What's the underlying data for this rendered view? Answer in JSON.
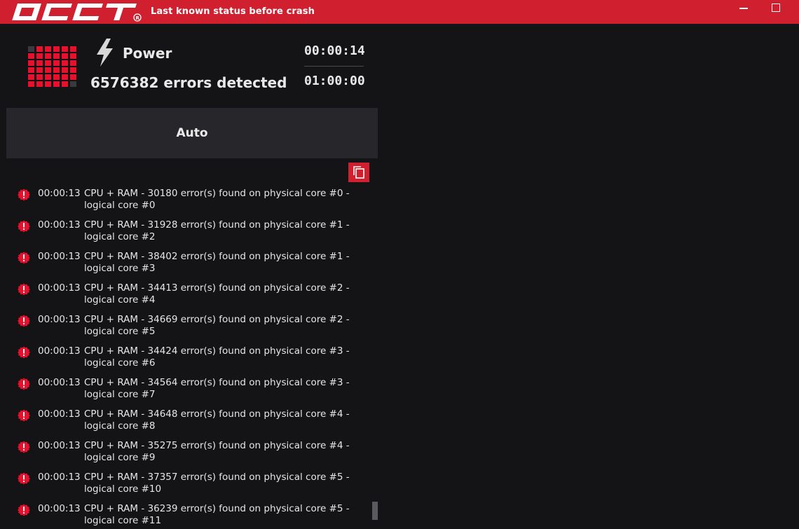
{
  "app": {
    "logo_text": "OCCT",
    "title": "Last known status before crash"
  },
  "window_controls": {
    "minimize_icon": "minimize-icon",
    "maximize_icon": "maximize-icon"
  },
  "colors": {
    "brand_red": "#d0202f",
    "background": "#141416",
    "panel": "#27272b"
  },
  "status": {
    "test_icon": "lightning-bolt-icon",
    "test_name": "Power",
    "errors_detected": "6576382 errors detected",
    "time_elapsed": "00:00:14",
    "time_total": "01:00:00"
  },
  "mode": {
    "label": "Auto"
  },
  "log": {
    "copy_icon": "copy-icon",
    "entries": [
      {
        "time": "00:00:13",
        "message": "CPU + RAM - 30180 error(s) found on physical core #0 - logical core #0"
      },
      {
        "time": "00:00:13",
        "message": "CPU + RAM - 31928 error(s) found on physical core #1 - logical core #2"
      },
      {
        "time": "00:00:13",
        "message": "CPU + RAM - 38402 error(s) found on physical core #1 - logical core #3"
      },
      {
        "time": "00:00:13",
        "message": "CPU + RAM - 34413 error(s) found on physical core #2 - logical core #4"
      },
      {
        "time": "00:00:13",
        "message": "CPU + RAM - 34669 error(s) found on physical core #2 - logical core #5"
      },
      {
        "time": "00:00:13",
        "message": "CPU + RAM - 34424 error(s) found on physical core #3 - logical core #6"
      },
      {
        "time": "00:00:13",
        "message": "CPU + RAM - 34564 error(s) found on physical core #3 - logical core #7"
      },
      {
        "time": "00:00:13",
        "message": "CPU + RAM - 34648 error(s) found on physical core #4 - logical core #8"
      },
      {
        "time": "00:00:13",
        "message": "CPU + RAM - 35275 error(s) found on physical core #4 - logical core #9"
      },
      {
        "time": "00:00:13",
        "message": "CPU + RAM - 37357 error(s) found on physical core #5 - logical core #10"
      },
      {
        "time": "00:00:13",
        "message": "CPU + RAM - 36239 error(s) found on physical core #5 - logical core #11"
      }
    ]
  }
}
